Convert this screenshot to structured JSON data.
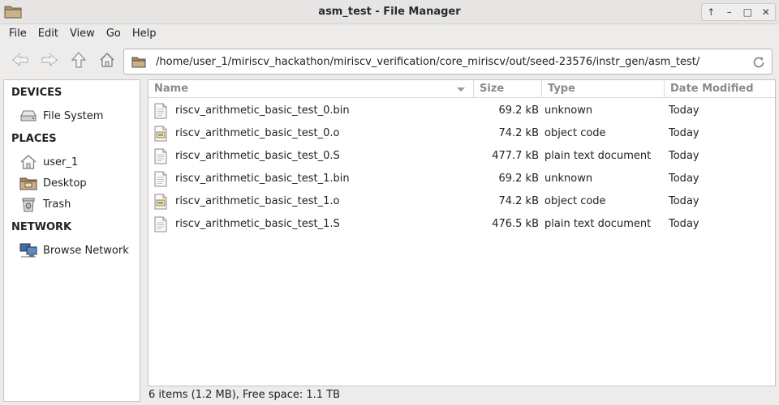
{
  "window": {
    "title": "asm_test - File Manager",
    "controls": [
      "↑",
      "–",
      "□",
      "✕"
    ]
  },
  "menu": [
    "File",
    "Edit",
    "View",
    "Go",
    "Help"
  ],
  "location": {
    "path": "/home/user_1/miriscv_hackathon/miriscv_verification/core_miriscv/out/seed-23576/instr_gen/asm_test/"
  },
  "sidebar": {
    "sections": [
      {
        "header": "DEVICES",
        "items": [
          {
            "label": "File System",
            "icon": "drive-icon"
          }
        ]
      },
      {
        "header": "PLACES",
        "items": [
          {
            "label": "user_1",
            "icon": "home-icon"
          },
          {
            "label": "Desktop",
            "icon": "desktop-folder-icon"
          },
          {
            "label": "Trash",
            "icon": "trash-icon"
          }
        ]
      },
      {
        "header": "NETWORK",
        "items": [
          {
            "label": "Browse Network",
            "icon": "network-icon"
          }
        ]
      }
    ]
  },
  "columns": [
    "Name",
    "Size",
    "Type",
    "Date Modified"
  ],
  "files": [
    {
      "name": "riscv_arithmetic_basic_test_0.bin",
      "size": "69.2 kB",
      "type": "unknown",
      "date": "Today",
      "icon": "binary-file-icon"
    },
    {
      "name": "riscv_arithmetic_basic_test_0.o",
      "size": "74.2 kB",
      "type": "object code",
      "date": "Today",
      "icon": "object-file-icon"
    },
    {
      "name": "riscv_arithmetic_basic_test_0.S",
      "size": "477.7 kB",
      "type": "plain text document",
      "date": "Today",
      "icon": "text-file-icon"
    },
    {
      "name": "riscv_arithmetic_basic_test_1.bin",
      "size": "69.2 kB",
      "type": "unknown",
      "date": "Today",
      "icon": "binary-file-icon"
    },
    {
      "name": "riscv_arithmetic_basic_test_1.o",
      "size": "74.2 kB",
      "type": "object code",
      "date": "Today",
      "icon": "object-file-icon"
    },
    {
      "name": "riscv_arithmetic_basic_test_1.S",
      "size": "476.5 kB",
      "type": "plain text document",
      "date": "Today",
      "icon": "text-file-icon"
    }
  ],
  "status": "6 items (1.2 MB), Free space: 1.1 TB"
}
